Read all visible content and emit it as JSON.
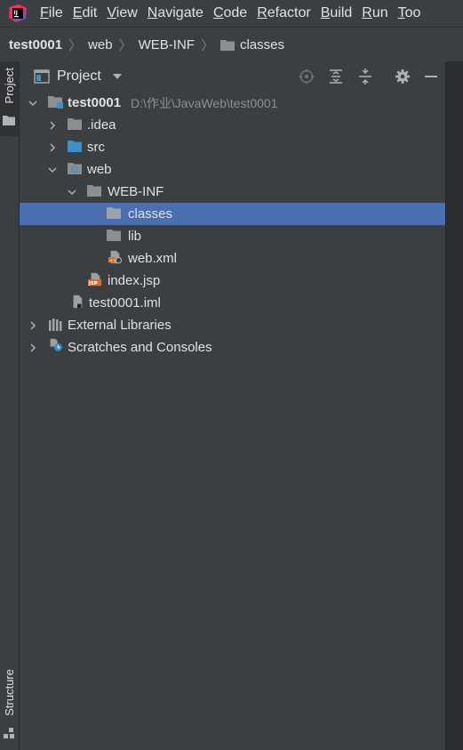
{
  "menubar": {
    "items": [
      {
        "label": "File",
        "mnemonic": "F",
        "rest": "ile"
      },
      {
        "label": "Edit",
        "mnemonic": "E",
        "rest": "dit"
      },
      {
        "label": "View",
        "mnemonic": "V",
        "rest": "iew"
      },
      {
        "label": "Navigate",
        "mnemonic": "N",
        "rest": "avigate"
      },
      {
        "label": "Code",
        "mnemonic": "C",
        "rest": "ode"
      },
      {
        "label": "Refactor",
        "mnemonic": "R",
        "rest": "efactor"
      },
      {
        "label": "Build",
        "mnemonic": "B",
        "rest": "uild"
      },
      {
        "label": "Run",
        "mnemonic": "R",
        "rest": "un"
      },
      {
        "label": "Tools",
        "mnemonic": "T",
        "rest": "oo"
      }
    ]
  },
  "breadcrumb": {
    "project": "test0001",
    "web": "web",
    "webinf": "WEB-INF",
    "classes": "classes"
  },
  "left_strip": {
    "project_tab": "Project",
    "structure_tab": "Structure"
  },
  "panel": {
    "title": "Project"
  },
  "tree": {
    "root_name": "test0001",
    "root_path": "D:\\作业\\JavaWeb\\test0001",
    "idea": ".idea",
    "src": "src",
    "web": "web",
    "webinf": "WEB-INF",
    "classes": "classes",
    "lib": "lib",
    "webxml": "web.xml",
    "indexjsp": "index.jsp",
    "iml": "test0001.iml",
    "external": "External Libraries",
    "scratches": "Scratches and Consoles"
  },
  "icons": {
    "folder_color": "#8b8f94",
    "source_folder_color": "#3d8fc6",
    "selection_color": "#4b6eaf",
    "jsp_color": "#d46f2b"
  }
}
